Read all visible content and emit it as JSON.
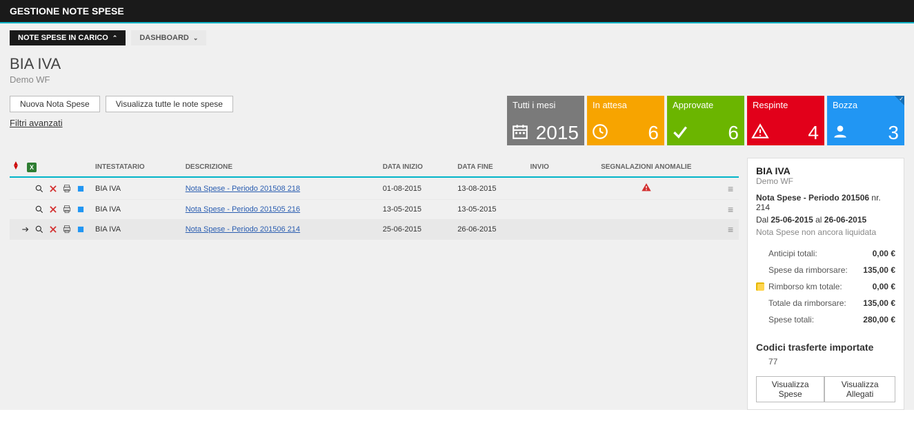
{
  "header": {
    "title": "GESTIONE NOTE SPESE"
  },
  "tabs": {
    "active": "NOTE SPESE IN CARICO",
    "inactive": "DASHBOARD"
  },
  "page": {
    "title": "BIA IVA",
    "subtitle": "Demo WF"
  },
  "buttons": {
    "new": "Nuova Nota Spese",
    "viewAll": "Visualizza tutte le note spese",
    "filters": "Filtri avanzati"
  },
  "tiles": [
    {
      "label": "Tutti i mesi",
      "value": "2015",
      "color": "t-gray",
      "icon": "calendar"
    },
    {
      "label": "In attesa",
      "value": "6",
      "color": "t-orange",
      "icon": "clock"
    },
    {
      "label": "Approvate",
      "value": "6",
      "color": "t-green",
      "icon": "check"
    },
    {
      "label": "Respinte",
      "value": "4",
      "color": "t-red",
      "icon": "warn"
    },
    {
      "label": "Bozza",
      "value": "3",
      "color": "t-blue",
      "icon": "user",
      "corner": true
    }
  ],
  "table": {
    "headers": {
      "intestatario": "Intestatario",
      "descrizione": "Descrizione",
      "dataInizio": "Data Inizio",
      "dataFine": "Data Fine",
      "invio": "Invio",
      "segnalazioni": "Segnalazioni Anomalie"
    },
    "rows": [
      {
        "intestatario": "BIA IVA",
        "descrizione": "Nota Spese - Periodo 201508 218",
        "dataInizio": "01-08-2015",
        "dataFine": "13-08-2015",
        "invio": "",
        "anomalia": true,
        "selected": false,
        "arrow": false
      },
      {
        "intestatario": "BIA IVA",
        "descrizione": "Nota Spese - Periodo 201505 216",
        "dataInizio": "13-05-2015",
        "dataFine": "13-05-2015",
        "invio": "",
        "anomalia": false,
        "selected": false,
        "arrow": false
      },
      {
        "intestatario": "BIA IVA",
        "descrizione": "Nota Spese - Periodo 201506 214",
        "dataInizio": "25-06-2015",
        "dataFine": "26-06-2015",
        "invio": "",
        "anomalia": false,
        "selected": true,
        "arrow": true
      }
    ]
  },
  "side": {
    "title": "BIA IVA",
    "subtitle": "Demo WF",
    "descPrefix": "Nota Spese - Periodo 201506",
    "nrLabel": "nr.",
    "nrValue": "214",
    "dalLabel": "Dal",
    "dalValue": "25-06-2015",
    "alLabel": "al",
    "alValue": "26-06-2015",
    "status": "Nota Spese non ancora liquidata",
    "rows": [
      {
        "label": "Anticipi totali:",
        "value": "0,00 €",
        "note": false
      },
      {
        "label": "Spese da rimborsare:",
        "value": "135,00 €",
        "note": false
      },
      {
        "label": "Rimborso km totale:",
        "value": "0,00 €",
        "note": true
      },
      {
        "label": "Totale da rimborsare:",
        "value": "135,00 €",
        "note": false
      },
      {
        "label": "Spese totali:",
        "value": "280,00 €",
        "note": false
      }
    ],
    "codesTitle": "Codici trasferte importate",
    "codes": "77",
    "btnSpese": "Visualizza Spese",
    "btnAllegati": "Visualizza Allegati"
  }
}
